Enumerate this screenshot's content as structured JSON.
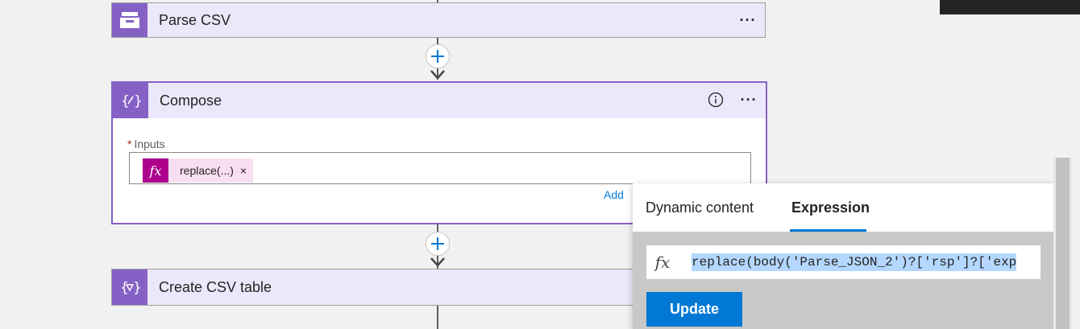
{
  "cards": {
    "parse_csv": {
      "title": "Parse CSV",
      "more": "···"
    },
    "compose": {
      "title": "Compose",
      "more": "···",
      "inputs_required_mark": "*",
      "inputs_label": "Inputs",
      "token_label": "replace(...)",
      "token_close": "×",
      "add_link": "Add"
    },
    "create_csv": {
      "title": "Create CSV table"
    }
  },
  "popup": {
    "tabs": [
      {
        "label": "Dynamic content",
        "active": false
      },
      {
        "label": "Expression",
        "active": true
      }
    ],
    "expression_text": "replace(body('Parse_JSON_2')?['rsp']?['exp",
    "update_label": "Update"
  },
  "colors": {
    "card_header": "#ece8fb",
    "action_icon": "#8661c5",
    "fx_token": "#ad008c",
    "accent": "#0078d4"
  },
  "icons": {
    "parse_csv": "archive-box-icon",
    "compose": "braces-pen-icon",
    "create_csv": "braces-filter-icon",
    "add": "plus-icon",
    "more": "ellipsis-icon",
    "info": "info-icon",
    "fx": "function-icon"
  }
}
